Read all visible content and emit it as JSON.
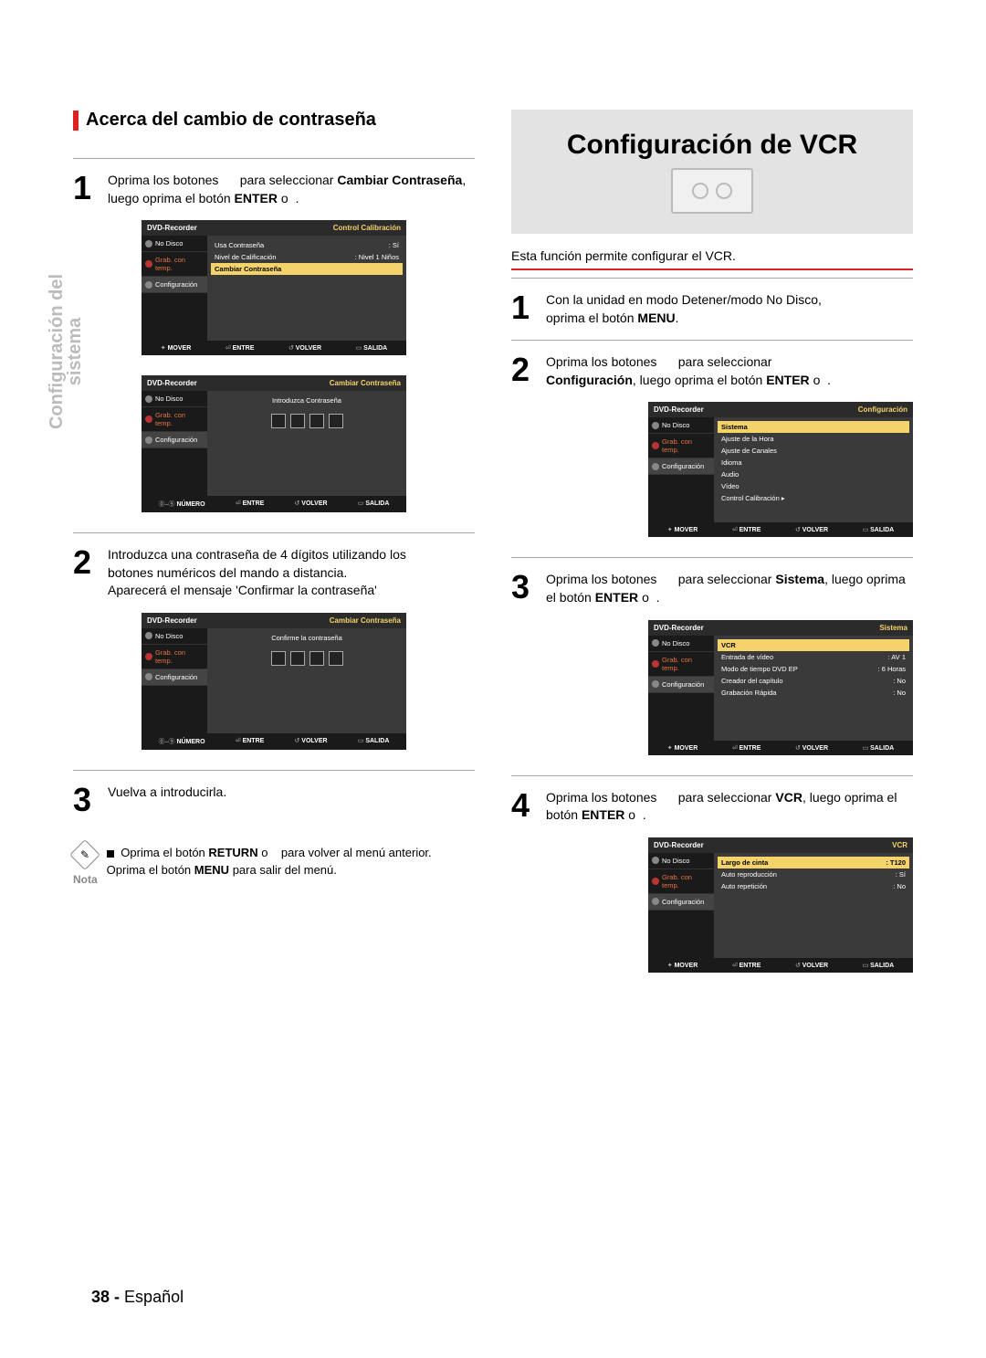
{
  "vtab_line1": "Configuración del",
  "vtab_line2": "sistema",
  "left": {
    "heading": "Acerca del cambio de contraseña",
    "step1": {
      "num": "1",
      "prefix": "Oprima los botones",
      "mid": "para seleccionar",
      "bold1": "Cambiar Contraseña",
      "tail": ", luego oprima el botón",
      "bold2": "ENTER",
      "tail2": "o"
    },
    "step2": {
      "num": "2",
      "l1": "Introduzca una contraseña de 4 dígitos utilizando los",
      "l2": "botones numéricos del mando a distancia.",
      "l3": "Aparecerá el mensaje 'Confirmar la contraseña'"
    },
    "step3": {
      "num": "3",
      "text": "Vuelva a introducirla."
    },
    "note": {
      "label": "Nota",
      "l1a": "Oprima el botón",
      "l1b": "RETURN",
      "l1c": "o",
      "l1d": "para volver al menú anterior.",
      "l2a": "Oprima el botón",
      "l2b": "MENU",
      "l2c": "para salir del menú."
    }
  },
  "right": {
    "big_title": "Configuración de VCR",
    "intro": "Esta función permite configurar el VCR.",
    "step1": {
      "num": "1",
      "l1": "Con la unidad en modo Detener/modo No Disco,",
      "l2a": "oprima el botón",
      "l2b": "MENU",
      "l2c": "."
    },
    "step2": {
      "num": "2",
      "prefix": "Oprima los botones",
      "mid": "para seleccionar",
      "bold1": "Configuración",
      "tail": ", luego oprima el botón",
      "bold2": "ENTER",
      "tail2": "o"
    },
    "step3": {
      "num": "3",
      "prefix": "Oprima los botones",
      "mid": "para seleccionar",
      "bold1": "Sistema",
      "tail": ", luego oprima el botón",
      "bold2": "ENTER",
      "tail2": "o"
    },
    "step4": {
      "num": "4",
      "prefix": "Oprima los botones",
      "mid": "para seleccionar",
      "bold1": "VCR",
      "tail": ", luego oprima el botón",
      "bold2": "ENTER",
      "tail2": "o"
    }
  },
  "osd_common": {
    "title": "DVD-Recorder",
    "side": {
      "nodisc": "No Disco",
      "grab": "Grab. con temp.",
      "conf": "Configuración"
    },
    "foot": {
      "mover": "MOVER",
      "numero": "NÚMERO",
      "entre": "ENTRE",
      "volver": "VOLVER",
      "salida": "SALIDA"
    }
  },
  "osd1": {
    "crumb": "Control Calibración",
    "rows": [
      {
        "k": "Usa Contraseña",
        "v": ": Sí",
        "hl": false
      },
      {
        "k": "Nivel de Calificación",
        "v": ": Nivel 1 Niños",
        "hl": false
      },
      {
        "k": "Cambiar Contraseña",
        "v": "",
        "hl": true
      }
    ]
  },
  "osd2": {
    "crumb": "Cambiar Contraseña",
    "prompt": "Introduzca Contraseña"
  },
  "osd3": {
    "crumb": "Cambiar Contraseña",
    "prompt": "Confirme la contraseña"
  },
  "osd4": {
    "crumb": "Configuración",
    "rows": [
      {
        "k": "Sistema",
        "v": "",
        "hl": true
      },
      {
        "k": "Ajuste de la Hora",
        "v": "",
        "hl": false
      },
      {
        "k": "Ajuste de Canales",
        "v": "",
        "hl": false
      },
      {
        "k": "Idioma",
        "v": "",
        "hl": false
      },
      {
        "k": "Audio",
        "v": "",
        "hl": false
      },
      {
        "k": "Vídeo",
        "v": "",
        "hl": false
      },
      {
        "k": "Control Calibración ▸",
        "v": "",
        "hl": false
      }
    ]
  },
  "osd5": {
    "crumb": "Sistema",
    "rows": [
      {
        "k": "VCR",
        "v": "",
        "hl": true
      },
      {
        "k": "Entrada de vídeo",
        "v": ": AV 1",
        "hl": false
      },
      {
        "k": "Modo de tiempo DVD EP",
        "v": ": 6 Horas",
        "hl": false
      },
      {
        "k": "Creador del capítulo",
        "v": ": No",
        "hl": false
      },
      {
        "k": "Grabación Rápida",
        "v": ": No",
        "hl": false
      }
    ]
  },
  "osd6": {
    "crumb": "VCR",
    "rows": [
      {
        "k": "Largo de cinta",
        "v": ": T120",
        "hl": true
      },
      {
        "k": "Auto reproducción",
        "v": ": Sí",
        "hl": false
      },
      {
        "k": "Auto repetición",
        "v": ": No",
        "hl": false
      }
    ]
  },
  "footer": {
    "num": "38 -",
    "lang": "Español"
  }
}
